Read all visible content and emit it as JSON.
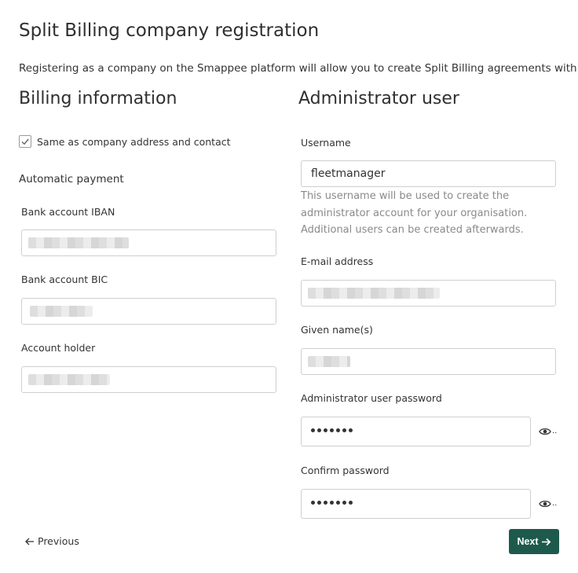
{
  "page": {
    "title": "Split Billing company registration",
    "intro": "Registering as a company on the Smappee platform will allow you to create Split Billing agreements with your employees."
  },
  "billing": {
    "title": "Billing information",
    "same_as_company_label": "Same as company address and contact",
    "same_as_company_checked": true,
    "automatic_payment_heading": "Automatic payment",
    "iban_label": "Bank account IBAN",
    "bic_label": "Bank account BIC",
    "holder_label": "Account holder"
  },
  "admin": {
    "title": "Administrator user",
    "username_label": "Username",
    "username_value": "fleetmanager",
    "username_help": "This username will be used to create the administrator account for your organisation. Additional users can be created afterwards.",
    "email_label": "E-mail address",
    "given_name_label": "Given name(s)",
    "password_label": "Administrator user password",
    "confirm_password_label": "Confirm password",
    "ellipsis": ".."
  },
  "footer": {
    "previous_label": "Previous",
    "next_label": "Next"
  },
  "icons": {
    "checkbox": "check-icon",
    "show_password": "eye-icon",
    "previous": "arrow-left-icon",
    "next": "arrow-right-icon"
  },
  "colors": {
    "primary_button": "#1e5a4c",
    "helper_text": "#8a8a8a",
    "input_border": "#cfcfcf"
  }
}
